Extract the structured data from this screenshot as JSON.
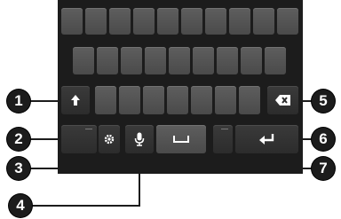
{
  "keyboard": {
    "icons": {
      "shift": "shift-arrow-icon",
      "delete": "backspace-icon",
      "settings": "gear-icon",
      "voice": "microphone-icon",
      "space": "space-bar-icon",
      "enter": "enter-return-icon"
    }
  },
  "callouts": [
    "1",
    "2",
    "3",
    "4",
    "5",
    "6",
    "7"
  ],
  "colors": {
    "keyboard_bg": "#1c1c1c",
    "key_light": "#555555",
    "key_dark": "#333333",
    "callout_bg": "#1c1c1c",
    "callout_text": "#ffffff"
  }
}
